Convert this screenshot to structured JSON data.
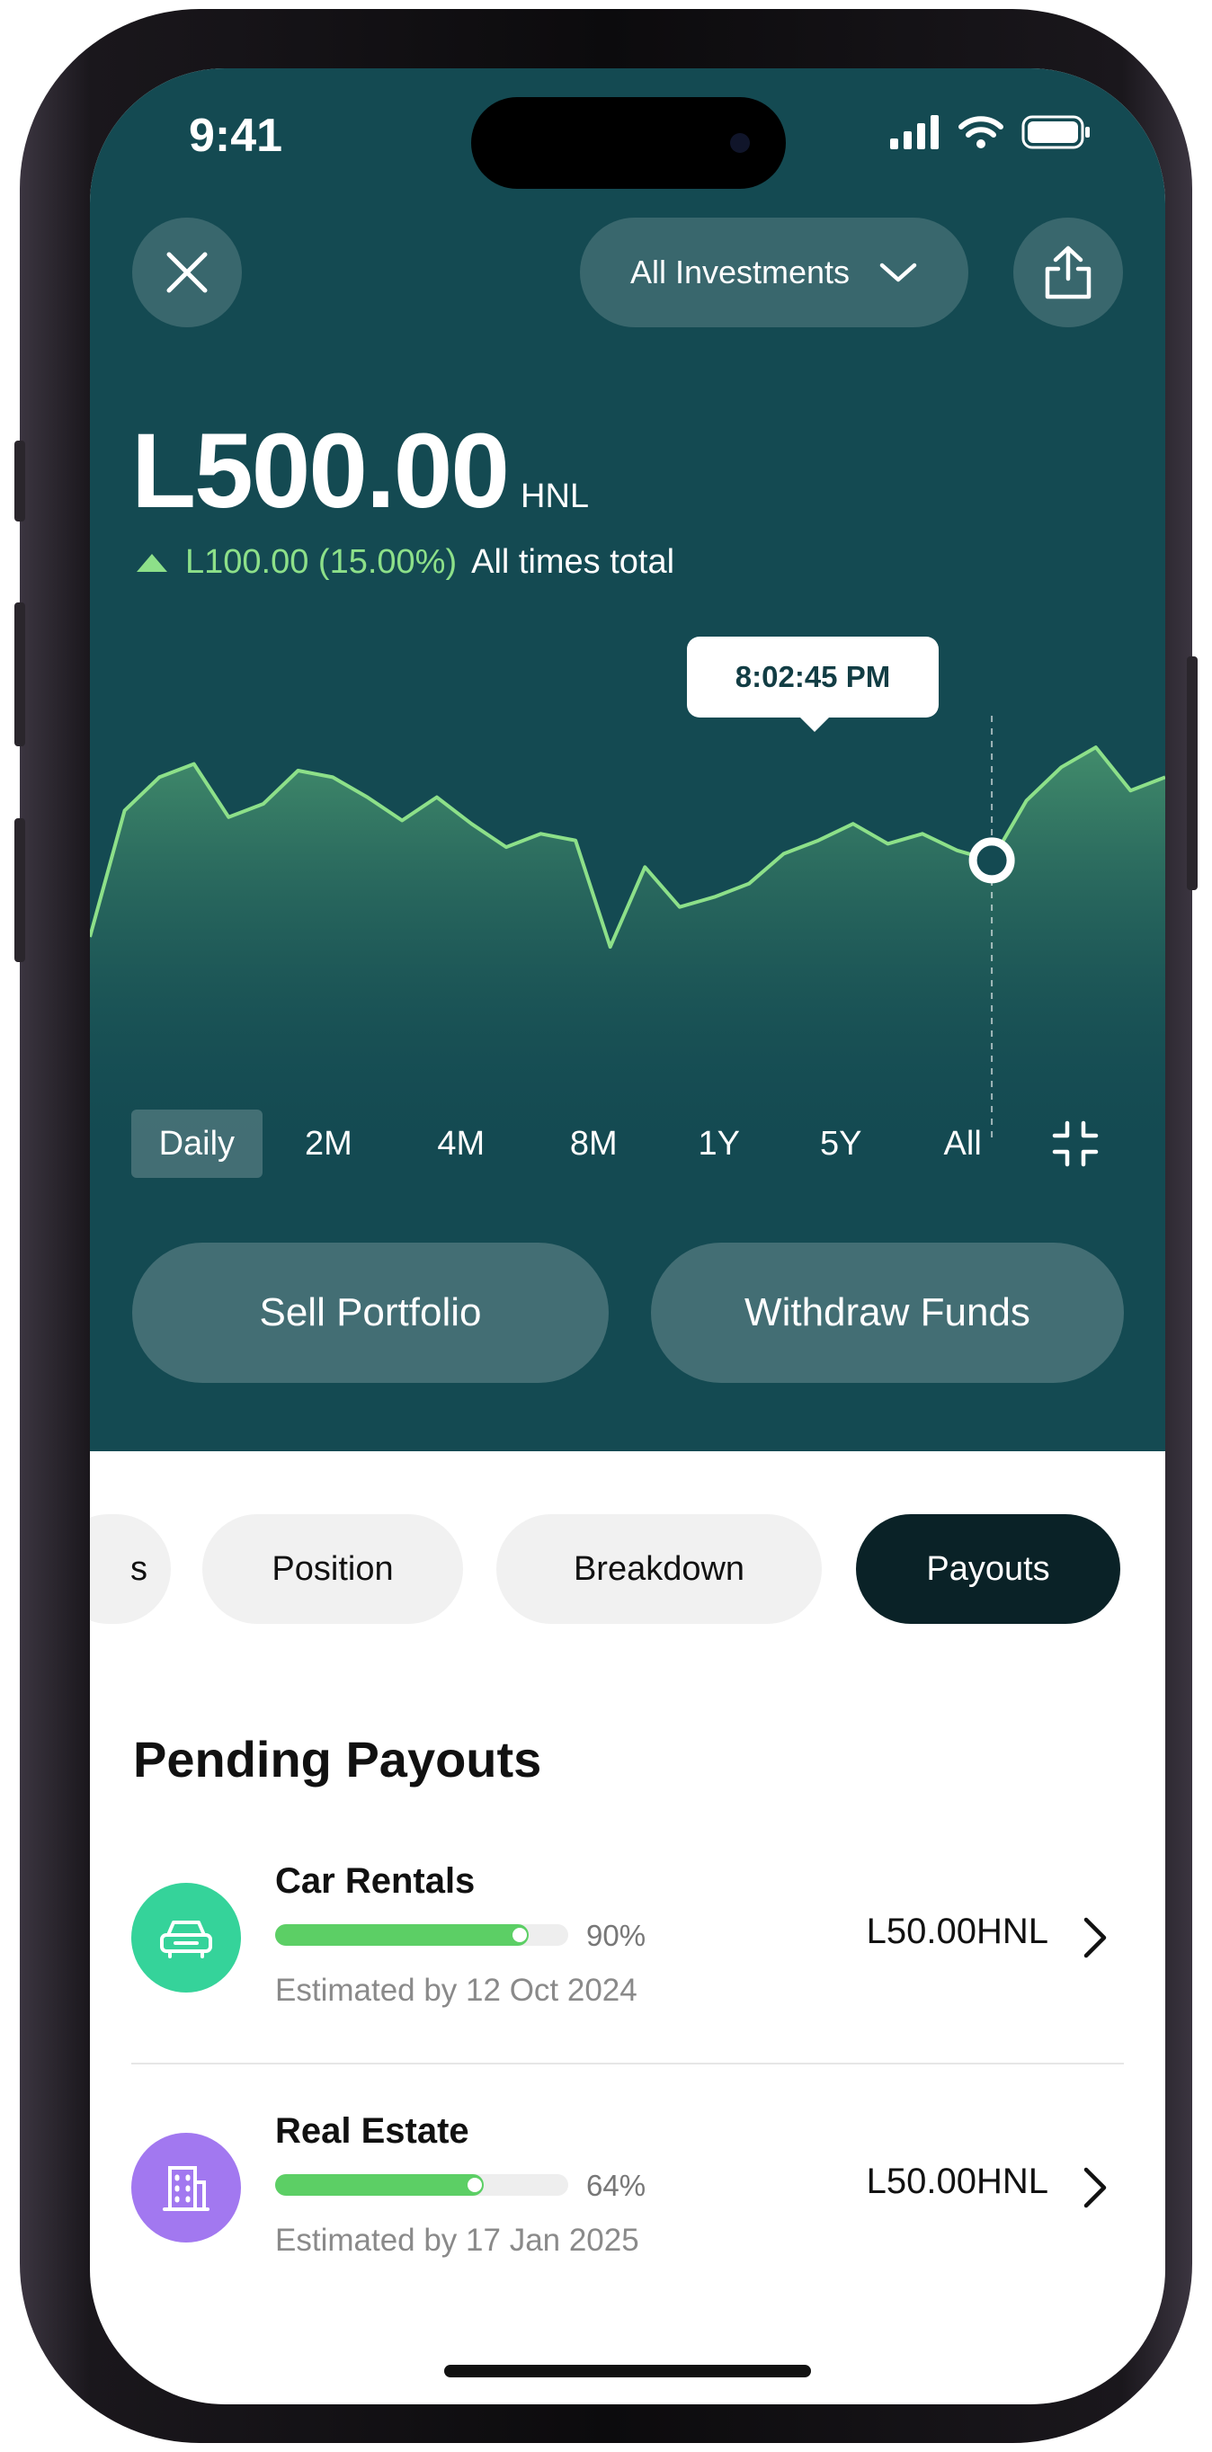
{
  "status_bar": {
    "time": "9:41"
  },
  "header": {
    "dropdown_label": "All Investments"
  },
  "balance": {
    "amount": "L500.00",
    "currency": "HNL",
    "change_value": "L100.00 (15.00%)",
    "change_label": "All times total"
  },
  "chart_data": {
    "type": "area",
    "title": "",
    "xlabel": "",
    "ylabel": "",
    "grid": false,
    "tooltip_label": "8:02:45 PM",
    "highlight_index": 26,
    "ylim": [
      0,
      100
    ],
    "values": [
      20,
      58,
      68,
      72,
      56,
      60,
      70,
      68,
      62,
      55,
      62,
      54,
      47,
      51,
      49,
      17,
      41,
      29,
      32,
      36,
      45,
      49,
      54,
      48,
      51,
      46,
      43,
      61,
      71,
      77,
      64,
      68
    ],
    "line_color": "#8de089"
  },
  "range_selector": {
    "options": [
      {
        "label": "Daily",
        "active": true
      },
      {
        "label": "2M",
        "active": false
      },
      {
        "label": "4M",
        "active": false
      },
      {
        "label": "8M",
        "active": false
      },
      {
        "label": "1Y",
        "active": false
      },
      {
        "label": "5Y",
        "active": false
      },
      {
        "label": "All",
        "active": false
      }
    ]
  },
  "actions": {
    "sell": "Sell Portfolio",
    "withdraw": "Withdraw Funds"
  },
  "tabs": [
    {
      "label": "s",
      "active": false
    },
    {
      "label": "Position",
      "active": false
    },
    {
      "label": "Breakdown",
      "active": false
    },
    {
      "label": "Payouts",
      "active": true
    }
  ],
  "pending": {
    "title": "Pending Payouts",
    "items": [
      {
        "name": "Car Rentals",
        "progress": 0.9,
        "percent": "90%",
        "estimate": "Estimated by 12 Oct 2024",
        "amount": "L50.00HNL",
        "icon": "car-icon",
        "color": "#35d39a"
      },
      {
        "name": "Real Estate",
        "progress": 0.64,
        "percent": "64%",
        "estimate": "Estimated by 17 Jan 2025",
        "amount": "L50.00HNL",
        "icon": "building-icon",
        "color": "#a278f0"
      }
    ]
  },
  "colors": {
    "hero_bg": "#144a52",
    "accent_green": "#8de089",
    "active_tab": "#0a2227"
  }
}
